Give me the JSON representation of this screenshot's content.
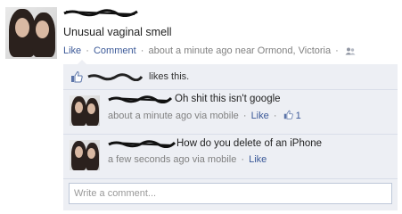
{
  "post": {
    "text": "Unusual vaginal smell",
    "like_label": "Like",
    "separator": "·",
    "comment_label": "Comment",
    "timestamp": "about a minute ago near Ormond, Victoria"
  },
  "likes": {
    "suffix": "likes this."
  },
  "comments": [
    {
      "text": "Oh shit this isn't google",
      "timestamp": "about a minute ago via mobile",
      "like_label": "Like",
      "like_count": "1"
    },
    {
      "text": "How do you delete of an iPhone",
      "timestamp": "a few seconds ago via mobile",
      "like_label": "Like"
    }
  ],
  "comment_box": {
    "placeholder": "Write a comment..."
  },
  "colors": {
    "link": "#3b5998",
    "meta": "#808080",
    "feedback_bg": "#edeff4",
    "input_border": "#bdc7d8"
  },
  "icons": {
    "audience": "friends-audience-icon",
    "like": "thumbs-up-icon",
    "redaction": "scribble-redaction"
  }
}
